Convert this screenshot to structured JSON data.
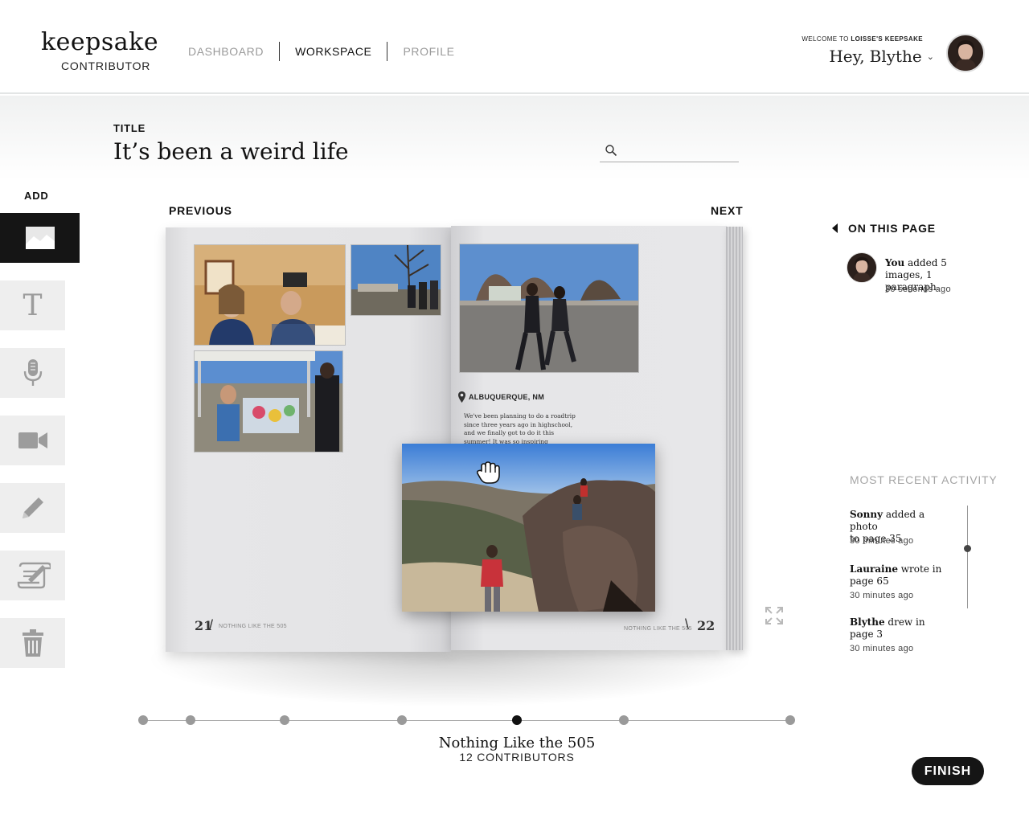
{
  "header": {
    "logo_main": "keepsake",
    "logo_sub": "CONTRIBUTOR",
    "nav": [
      {
        "label": "DASHBOARD",
        "active": false
      },
      {
        "label": "WORKSPACE",
        "active": true
      },
      {
        "label": "PROFILE",
        "active": false
      }
    ],
    "welcome_prefix": "WELCOME TO",
    "welcome_book": "LOISSE'S KEEPSAKE",
    "greeting": "Hey,",
    "user_name": "Blythe"
  },
  "title_section": {
    "label": "TITLE",
    "value": "It’s been a weird life",
    "search_placeholder": ""
  },
  "toolbar": {
    "label": "ADD",
    "tools": [
      {
        "name": "image-icon",
        "active": true
      },
      {
        "name": "text-icon",
        "active": false
      },
      {
        "name": "microphone-icon",
        "active": false
      },
      {
        "name": "video-camera-icon",
        "active": false
      },
      {
        "name": "pencil-icon",
        "active": false
      },
      {
        "name": "scroll-sign-icon",
        "active": false
      },
      {
        "name": "trash-icon",
        "active": false
      }
    ]
  },
  "book": {
    "previous_label": "PREVIOUS",
    "next_label": "NEXT",
    "left_page": {
      "number": "21",
      "running_title": "NOTHING LIKE THE 505"
    },
    "right_page": {
      "number": "22",
      "running_title": "NOTHING LIKE THE 505",
      "location": "ALBUQUERQUE, NM",
      "paragraph": "We've been planning to do a roadtrip since three years ago in highschool, and we finally got to do it this summer! It was so inspiring beautiful and I'm really excited"
    },
    "title": "Nothing Like the 505",
    "contributors": "12 CONTRIBUTORS",
    "timeline_dots": 7,
    "timeline_active_index": 4
  },
  "on_this_page": {
    "label": "ON THIS PAGE",
    "entry": {
      "actor": "You",
      "text": "added 5 images, 1 paragraph.",
      "time": "30 seconds ago"
    }
  },
  "recent_activity": {
    "label": "MOST RECENT ACTIVITY",
    "items": [
      {
        "actor": "Sonny",
        "text_line1": "added a photo",
        "text_line2": "to page 35",
        "time": "30 minutes ago"
      },
      {
        "actor": "Lauraine",
        "text_line1": "wrote in",
        "text_line2": "page 65",
        "time": "30 minutes ago"
      },
      {
        "actor": "Blythe",
        "text_line1": "drew in",
        "text_line2": "page 3",
        "time": "30 minutes ago"
      }
    ]
  },
  "finish_label": "FINISH",
  "colors": {
    "accent": "#151515",
    "muted": "#9a9a9a",
    "page": "#e6e6e8"
  }
}
